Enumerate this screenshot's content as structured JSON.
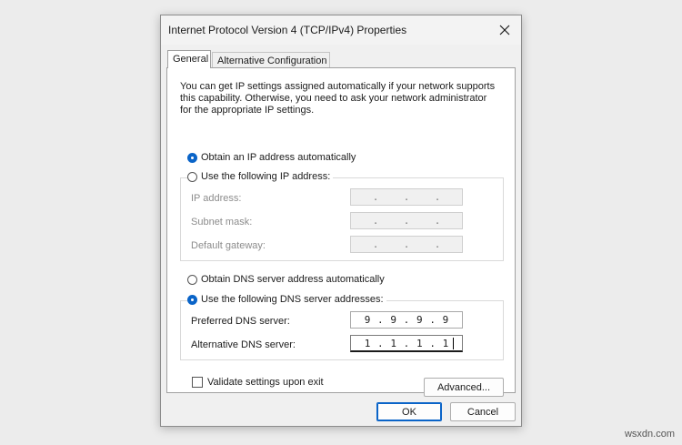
{
  "dialog": {
    "title": "Internet Protocol Version 4 (TCP/IPv4) Properties",
    "close_icon": "close-icon"
  },
  "tabs": [
    {
      "label": "General",
      "selected": true
    },
    {
      "label": "Alternative Configuration",
      "selected": false
    }
  ],
  "general": {
    "description": "You can get IP settings assigned automatically if your network supports this capability. Otherwise, you need to ask your network administrator for the appropriate IP settings.",
    "ip_auto_label": "Obtain an IP address automatically",
    "ip_manual_label": "Use the following IP address:",
    "ip_mode": "automatic",
    "ip_address_label": "IP address:",
    "subnet_mask_label": "Subnet mask:",
    "default_gateway_label": "Default gateway:",
    "dns_auto_label": "Obtain DNS server address automatically",
    "dns_manual_label": "Use the following DNS server addresses:",
    "dns_mode": "manual",
    "preferred_dns_label": "Preferred DNS server:",
    "preferred_dns": [
      "9",
      "9",
      "9",
      "9"
    ],
    "alternative_dns_label": "Alternative DNS server:",
    "alternative_dns": [
      "1",
      "1",
      "1",
      "1"
    ],
    "validate_label": "Validate settings upon exit",
    "validate_checked": false,
    "advanced_label": "Advanced..."
  },
  "footer": {
    "ok_label": "OK",
    "cancel_label": "Cancel"
  },
  "watermark": "wsxdn.com",
  "colors": {
    "accent": "#0a64c8",
    "disabled_text": "#8c8c8c"
  }
}
